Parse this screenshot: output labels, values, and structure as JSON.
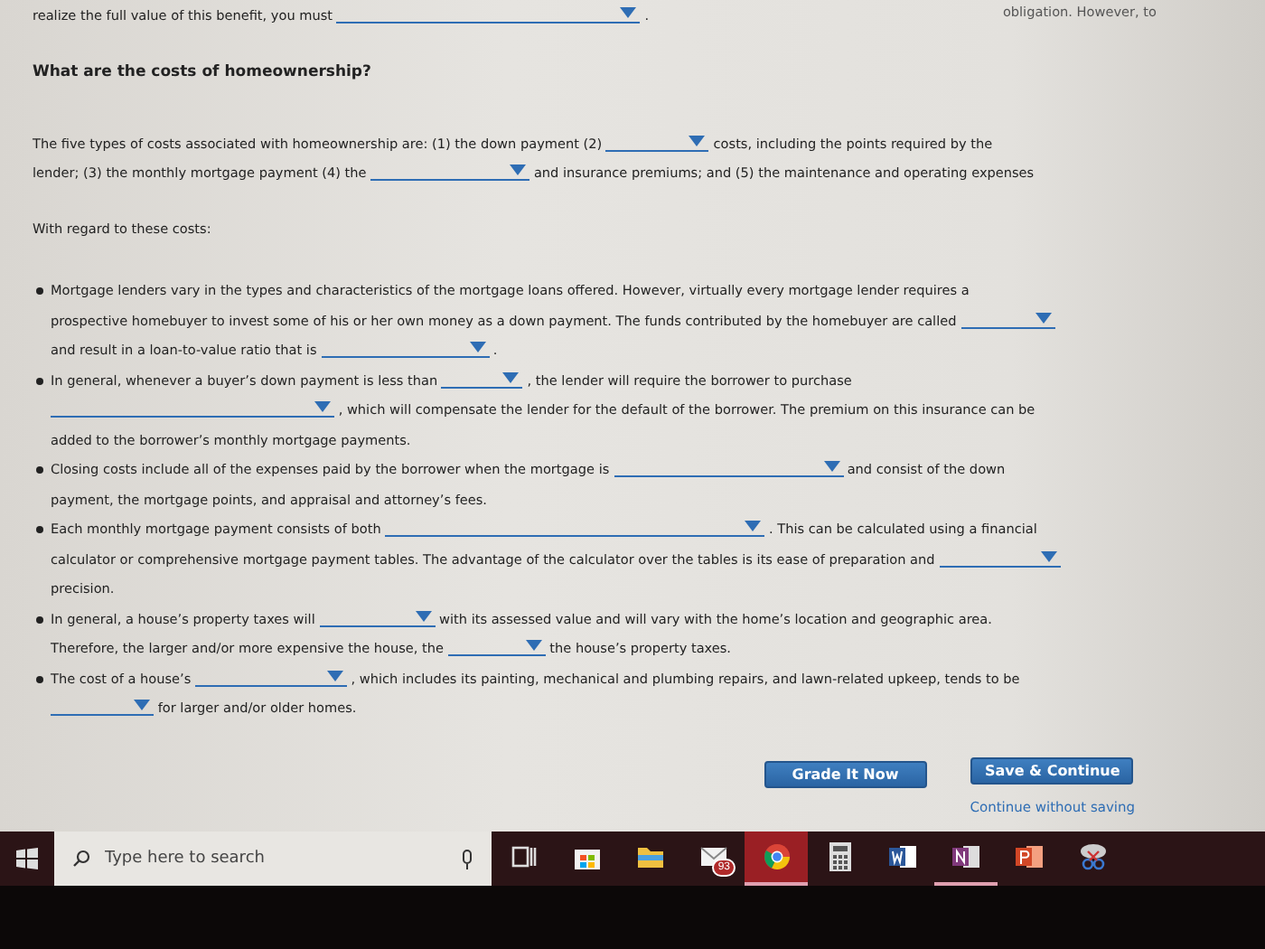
{
  "top_line": {
    "parts": [
      {
        "kind": "text",
        "text": "realize the full value of this benefit, you must"
      },
      {
        "kind": "select"
      },
      {
        "kind": "text",
        "text": "."
      }
    ],
    "right_text": "obligation. However, to"
  },
  "heading": "What are the costs of homeownership?",
  "intro": {
    "parts": [
      {
        "kind": "text",
        "text": "The five types of costs associated with homeownership are: (1) the down payment (2)"
      },
      {
        "kind": "select"
      },
      {
        "kind": "text",
        "text": "costs, including the points required by the"
      },
      {
        "kind": "text",
        "text": "lender; (3) the monthly mortgage payment (4) the"
      },
      {
        "kind": "select"
      },
      {
        "kind": "text",
        "text": "and insurance premiums; and (5) the maintenance and operating expenses"
      }
    ]
  },
  "lead": "With regard to these costs:",
  "bullets": [
    {
      "parts": [
        {
          "kind": "text",
          "text": "Mortgage lenders vary in the types and characteristics of the mortgage loans offered. However, virtually every mortgage lender requires a"
        },
        {
          "kind": "text",
          "text": "prospective homebuyer to invest some of his or her own money as a down payment. The funds contributed by the homebuyer are called"
        },
        {
          "kind": "select"
        },
        {
          "kind": "text",
          "text": "and result in a loan-to-value ratio that is"
        },
        {
          "kind": "select"
        },
        {
          "kind": "text",
          "text": "."
        }
      ]
    },
    {
      "parts": [
        {
          "kind": "text",
          "text": "In general, whenever a buyer’s down payment is less than"
        },
        {
          "kind": "select"
        },
        {
          "kind": "text",
          "text": ", the lender will require the borrower to purchase"
        },
        {
          "kind": "select"
        },
        {
          "kind": "text",
          "text": ", which will compensate the lender for the default of the borrower. The premium on this insurance can be"
        },
        {
          "kind": "text",
          "text": "added to the borrower’s monthly mortgage payments."
        }
      ]
    },
    {
      "parts": [
        {
          "kind": "text",
          "text": "Closing costs include all of the expenses paid by the borrower when the mortgage is"
        },
        {
          "kind": "select"
        },
        {
          "kind": "text",
          "text": "and consist of the down"
        },
        {
          "kind": "text",
          "text": "payment, the mortgage points, and appraisal and attorney’s fees."
        }
      ]
    },
    {
      "parts": [
        {
          "kind": "text",
          "text": "Each monthly mortgage payment consists of both"
        },
        {
          "kind": "select"
        },
        {
          "kind": "text",
          "text": ". This can be calculated using a financial"
        },
        {
          "kind": "text",
          "text": "calculator or comprehensive mortgage payment tables. The advantage of the calculator over the tables is its ease of preparation and"
        },
        {
          "kind": "select"
        },
        {
          "kind": "text",
          "text": "precision."
        }
      ]
    },
    {
      "parts": [
        {
          "kind": "text",
          "text": "In general, a house’s property taxes will"
        },
        {
          "kind": "select"
        },
        {
          "kind": "text",
          "text": "with its assessed value and will vary with the home’s location and geographic area."
        },
        {
          "kind": "text",
          "text": "Therefore, the larger and/or more expensive the house, the"
        },
        {
          "kind": "select"
        },
        {
          "kind": "text",
          "text": "the house’s property taxes."
        }
      ]
    },
    {
      "parts": [
        {
          "kind": "text",
          "text": "The cost of a house’s"
        },
        {
          "kind": "select"
        },
        {
          "kind": "text",
          "text": ", which includes its painting, mechanical and plumbing repairs, and lawn-related upkeep, tends to be"
        },
        {
          "kind": "select"
        },
        {
          "kind": "text",
          "text": "for larger and/or older homes."
        }
      ]
    }
  ],
  "buttons": [
    {
      "label": "Grade It Now"
    },
    {
      "label": "Save & Continue"
    }
  ],
  "link": "Continue without saving",
  "taskbar": {
    "search_placeholder": "Type here to search",
    "apps": [
      {
        "kind": "task-view",
        "active": false,
        "running": false
      },
      {
        "kind": "store",
        "active": false,
        "running": false
      },
      {
        "kind": "folder",
        "active": false,
        "running": false
      },
      {
        "kind": "mail",
        "badge": "93",
        "active": false,
        "running": false
      },
      {
        "kind": "browser",
        "active": true,
        "running": true
      },
      {
        "kind": "calculator",
        "active": false,
        "running": false
      },
      {
        "kind": "word",
        "active": false,
        "running": false
      },
      {
        "kind": "onenote",
        "active": false,
        "running": true
      },
      {
        "kind": "powerpoint",
        "active": false,
        "running": false
      },
      {
        "kind": "snip",
        "active": false,
        "running": false
      }
    ]
  }
}
